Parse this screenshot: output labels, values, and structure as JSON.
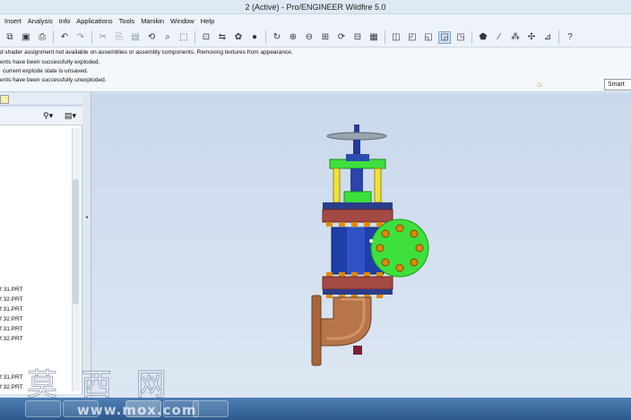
{
  "window": {
    "title": "2 (Active) - Pro/ENGINEER Wildfire 5.0"
  },
  "menu": [
    "Insert",
    "Analysis",
    "Info",
    "Applications",
    "Tools",
    "Manikin",
    "Window",
    "Help"
  ],
  "messages": [
    "d shader assignment not available on assemblies or assembly components. Removing textures from appearance.",
    "ents have been successfully exploded.",
    "current explode state is unsaved.",
    "ents have been successfully unexploded."
  ],
  "filter": {
    "value": "Smart"
  },
  "tree_items": [
    "f 31.PRT",
    "f 32.PRT",
    "f 31.PRT",
    "f 32.PRT",
    "f 31.PRT",
    "f 32.PRT",
    "f 31.PRT",
    "f 32.PRT"
  ],
  "watermark": {
    "chars": "莫 西 网",
    "url": "www.mox.com"
  },
  "colors": {
    "viewport_top": "#c9d8ec",
    "valve_body": "#1f3fa8",
    "flange": "#a44a44",
    "yoke": "#3ee03e",
    "stem_posts": "#f0e23a",
    "elbow": "#b8754a",
    "bolts": "#e08a00",
    "handwheel": "#8c97a3"
  }
}
